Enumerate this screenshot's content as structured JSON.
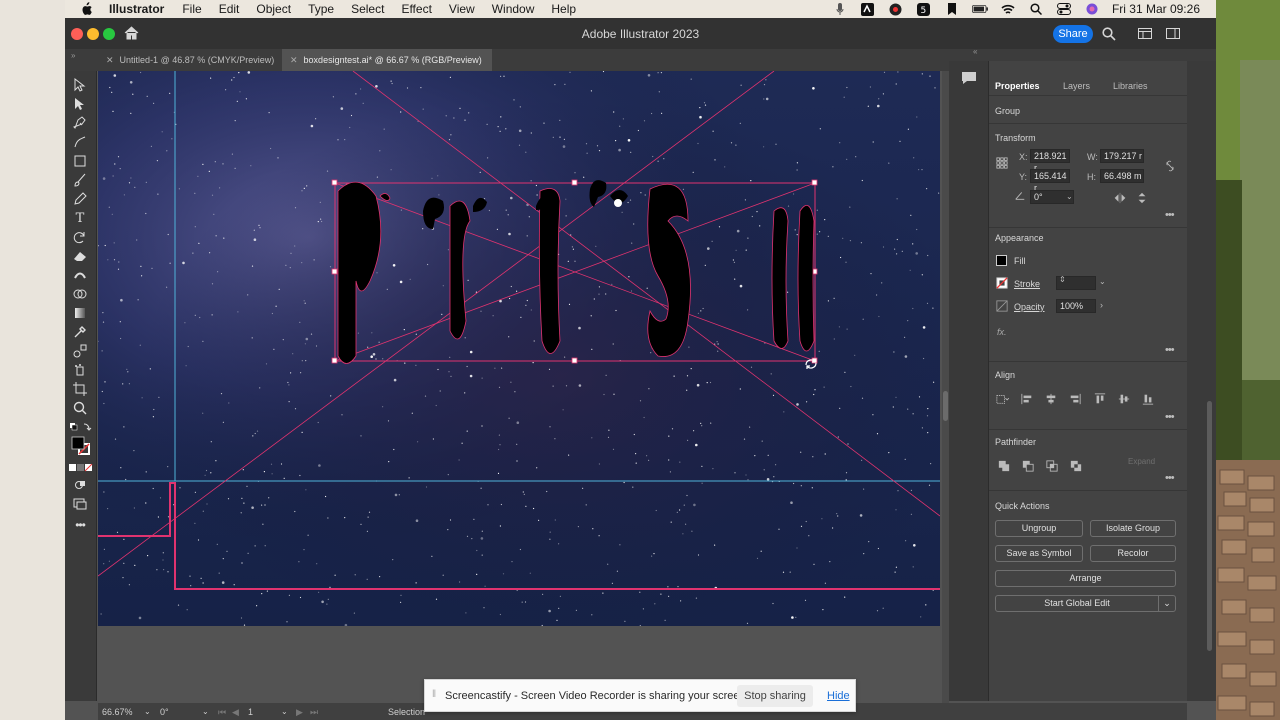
{
  "menubar": {
    "app_name": "Illustrator",
    "menus": [
      "File",
      "Edit",
      "Object",
      "Type",
      "Select",
      "Effect",
      "View",
      "Window",
      "Help"
    ],
    "clock": "Fri 31 Mar  09:26"
  },
  "window": {
    "title": "Adobe Illustrator 2023",
    "share_label": "Share"
  },
  "tabs": [
    {
      "label": "Untitled-1 @ 46.87 % (CMYK/Preview)"
    },
    {
      "label": "boxdesigntest.ai* @ 66.67 % (RGB/Preview)"
    }
  ],
  "artwork": {
    "warp_text": "PRESIL"
  },
  "panel": {
    "tabs": [
      "Properties",
      "Layers",
      "Libraries"
    ],
    "selection_type": "Group",
    "transform": {
      "title": "Transform",
      "x_label": "X:",
      "x_value": "218.921 r",
      "y_label": "Y:",
      "y_value": "165.414 r",
      "w_label": "W:",
      "w_value": "179.217 r",
      "h_label": "H:",
      "h_value": "66.498 m",
      "angle_value": "0°"
    },
    "appearance": {
      "title": "Appearance",
      "fill_label": "Fill",
      "stroke_label": "Stroke",
      "opacity_label": "Opacity",
      "opacity_value": "100%",
      "fx_label": "fx."
    },
    "align": {
      "title": "Align"
    },
    "pathfinder": {
      "title": "Pathfinder",
      "expand_label": "Expand"
    },
    "quick_actions": {
      "title": "Quick Actions",
      "ungroup": "Ungroup",
      "isolate_group": "Isolate Group",
      "save_as_symbol": "Save as Symbol",
      "recolor": "Recolor",
      "arrange": "Arrange",
      "start_global_edit": "Start Global Edit"
    }
  },
  "statusbar": {
    "zoom": "66.67%",
    "rotation": "0°",
    "artboard_num": "1",
    "tool": "Selection"
  },
  "share_banner": {
    "message": "Screencastify - Screen Video Recorder is sharing your screen.",
    "stop_label": "Stop sharing",
    "hide_label": "Hide"
  },
  "colors": {
    "accent": "#1473e6",
    "selection": "#e0336f",
    "guide": "#4fb3d9"
  }
}
